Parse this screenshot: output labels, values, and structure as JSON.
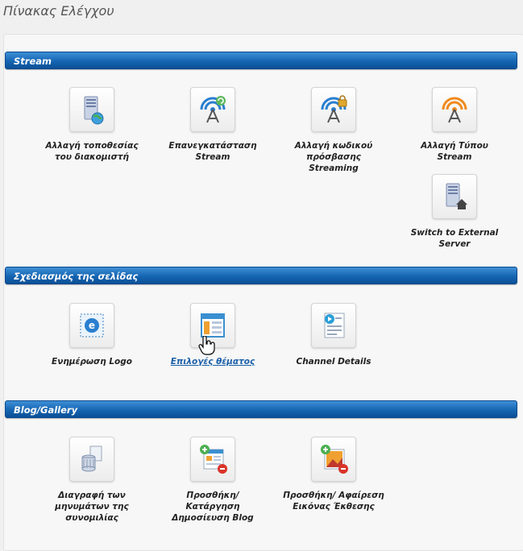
{
  "page_title": "Πίνακας Ελέγχου",
  "sections": [
    {
      "title": "Stream",
      "items": [
        {
          "label": "Αλλαγή τοποθεσίας του διακομιστή",
          "icon": "server-globe-icon"
        },
        {
          "label": "Επανεγκατάσταση Stream",
          "icon": "antenna-refresh-icon"
        },
        {
          "label": "Αλλαγή κωδικού πρόσβασης Streaming",
          "icon": "antenna-lock-icon"
        },
        {
          "label": "Αλλαγή Τύπου Stream",
          "icon": "antenna-orange-icon"
        },
        {
          "label": "Switch to External Server",
          "icon": "server-home-icon"
        }
      ]
    },
    {
      "title": "Σχεδιασμός της σελίδας",
      "items": [
        {
          "label": "Ενημέρωση Logo",
          "icon": "logo-frame-icon"
        },
        {
          "label": "Επιλογές θέματος",
          "icon": "theme-layout-icon"
        },
        {
          "label": "Channel Details",
          "icon": "channel-video-icon"
        }
      ]
    },
    {
      "title": "Blog/Gallery",
      "items": [
        {
          "label": "Διαγραφή των μηνυμάτων της συνομιλίας",
          "icon": "chat-delete-icon"
        },
        {
          "label": "Προσθήκη/ Κατάργηση Δημοσίευση Blog",
          "icon": "blog-add-remove-icon"
        },
        {
          "label": "Προσθήκη/ Αφαίρεση Εικόνας Έκθεσης",
          "icon": "image-add-remove-icon"
        }
      ]
    }
  ],
  "colors": {
    "header_blue": "#1565b2",
    "link_blue": "#1a5fa8",
    "antenna_blue": "#2a7fd0",
    "antenna_orange": "#f08a1c"
  }
}
